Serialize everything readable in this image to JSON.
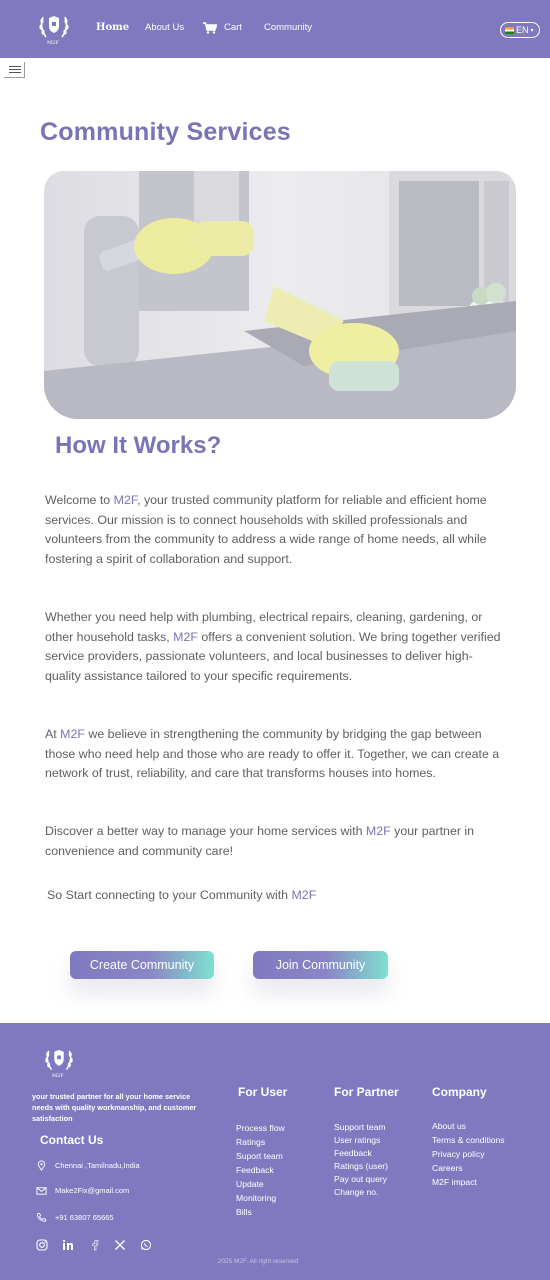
{
  "nav": {
    "logo_text": "M2F",
    "home": "Home",
    "about": "About Us",
    "cart": "Cart",
    "community": "Community",
    "language": "EN"
  },
  "icons": [
    "menu-icon",
    "cart-icon",
    "flag-icon",
    "location-icon",
    "mail-icon",
    "phone-icon",
    "instagram-icon",
    "linkedin-icon",
    "facebook-icon",
    "x-icon",
    "whatsapp-icon"
  ],
  "colors": {
    "brand": "#8079c0",
    "heading": "#7a74b6",
    "accent_gradient_end": "#7fe0cf"
  },
  "main": {
    "title": "Community Services",
    "subtitle": "How It Works?",
    "p1_a": "Welcome to ",
    "p1_hl": "M2F",
    "p1_b": ", your trusted community platform for reliable and efficient home services. Our mission is to connect households with skilled professionals and volunteers from the community to address a wide range of home needs, all while fostering a spirit of collaboration and support.",
    "p2_a": "Whether you need help with plumbing, electrical repairs, cleaning, gardening, or other household tasks, ",
    "p2_hl": "M2F",
    "p2_b": " offers a convenient solution. We bring together verified service providers, passionate volunteers, and local businesses to deliver high-quality assistance tailored to your specific requirements.",
    "p3_a": "At ",
    "p3_hl": "M2F",
    "p3_b": " we believe in strengthening the community by bridging the gap between those who need help and those who are ready to offer it. Together, we can create a network of trust, reliability, and care that transforms houses into homes.",
    "p4_a": "Discover a better way to manage your home services with ",
    "p4_hl": "M2F",
    "p4_b": " your partner in convenience and community care!",
    "start_a": "So Start connecting to your Community with ",
    "start_hl": "M2F",
    "create_button": "Create Community",
    "join_button": "Join Community"
  },
  "footer": {
    "logo_text": "M2F",
    "tagline": "your trusted partner for all your home service needs with quality workmanship, and customer satisfaction",
    "contact_heading": "Contact Us",
    "address": "Chennai ,Tamilnadu,India",
    "email": "Make2Fix@gmail.com",
    "phone": "+91  63807 65665",
    "for_user": {
      "heading": "For User",
      "items": [
        "Process flow",
        "Ratings",
        "Suport team",
        "Feedback",
        "Update",
        "Monitoring",
        "Bills"
      ]
    },
    "for_partner": {
      "heading": "For Partner",
      "items": [
        "Support team",
        "User ratings",
        "Feedback",
        "Ratings (user)",
        "Pay out query",
        "Change no."
      ]
    },
    "company": {
      "heading": "Company",
      "items": [
        "About us",
        "Terms & conditions",
        "Privacy policy",
        "Careers",
        "M2F impact"
      ]
    },
    "copyright": "2025 M2F. All right reserved"
  }
}
